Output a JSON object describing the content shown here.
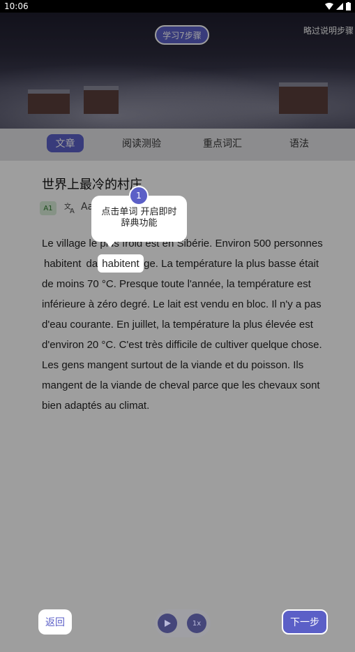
{
  "status_bar": {
    "time": "10:06",
    "icons": [
      "wifi-icon",
      "signal-icon",
      "battery-icon"
    ]
  },
  "header": {
    "steps_label": "学习7步骤",
    "skip_label": "略过说明步骤"
  },
  "tabs": [
    {
      "label": "文章",
      "active": true
    },
    {
      "label": "阅读测验",
      "active": false
    },
    {
      "label": "重点词汇",
      "active": false
    },
    {
      "label": "语法",
      "active": false
    }
  ],
  "article": {
    "title": "世界上最冷的村庄",
    "level": "A1",
    "font_icon_label": "Aa",
    "text_before": "Le village le plus froid est en Sibérie. Environ 500 personnes ",
    "highlight": "habitent",
    "text_after": " dans ce village. La température la plus basse était de moins 70 °C. Presque toute l'année, la température est inférieure à zéro degré. Le lait est vendu en bloc. Il n'y a pas d'eau courante. En juillet, la température la plus élevée est d'environ 20 °C. C'est très difficile de cultiver quelque chose. Les gens mangent surtout de la viande et du poisson. Ils mangent de la viande de cheval parce que les chevaux sont bien adaptés au climat."
  },
  "tooltip": {
    "step": "1",
    "line1": "点击单词 开启即时",
    "line2": "辞典功能"
  },
  "controls": {
    "back_label": "返回",
    "speed_label": "1x",
    "next_label": "下一步"
  },
  "colors": {
    "accent": "#5b5fc7",
    "overlay": "rgba(0,0,0,0.38)"
  }
}
